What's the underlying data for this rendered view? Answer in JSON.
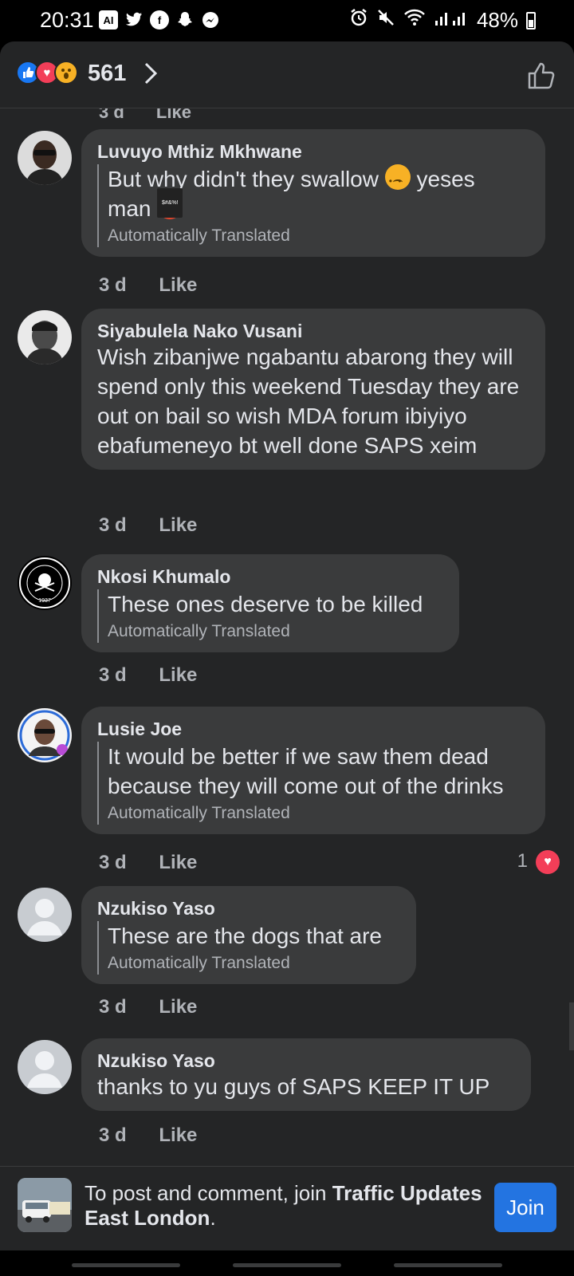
{
  "status_bar": {
    "time": "20:31",
    "left_icons": [
      "ai-icon",
      "twitter-icon",
      "facebook-icon",
      "snapchat-icon",
      "messenger-icon"
    ],
    "ai_label": "AI",
    "battery": "48%"
  },
  "reactions": {
    "icons": [
      "like",
      "love",
      "wow"
    ],
    "count": "561"
  },
  "ghost_meta": {
    "time": "3 d",
    "like": "Like"
  },
  "comments": [
    {
      "author": "Luvuyo Mthiz Mkhwane",
      "text_a": "But why didn't they swallow",
      "text_b": "yeses",
      "text_c": "man",
      "auto_translated": "Automatically Translated",
      "time": "3 d",
      "like": "Like"
    },
    {
      "author": "Siyabulela Nako Vusani",
      "text": "Wish zibanjwe ngabantu abarong they will spend only this weekend Tuesday they are out on bail so wish MDA forum ibiyiyo ebafumeneyo bt well done SAPS xeim",
      "time": "3 d",
      "like": "Like"
    },
    {
      "author": "Nkosi Khumalo",
      "text": "These ones deserve to be killed",
      "auto_translated": "Automatically Translated",
      "time": "3 d",
      "like": "Like",
      "avatar_text": "1937"
    },
    {
      "author": "Lusie Joe",
      "text": "It would be better if we saw them dead because they will come out of the drinks",
      "auto_translated": "Automatically Translated",
      "time": "3 d",
      "like": "Like",
      "reaction_count": "1"
    },
    {
      "author": "Nzukiso Yaso",
      "text": "These are the dogs that are",
      "auto_translated": "Automatically Translated",
      "time": "3 d",
      "like": "Like"
    },
    {
      "author": "Nzukiso Yaso",
      "text": "thanks to yu guys of SAPS KEEP IT UP",
      "time": "3 d",
      "like": "Like"
    }
  ],
  "join_bar": {
    "prefix": "To post and comment, join ",
    "group_name": "Traffic Updates East London",
    "suffix": ".",
    "button": "Join"
  },
  "colors": {
    "background": "#242526",
    "bubble": "#3a3b3c",
    "accent": "#2374e1",
    "love": "#f33e58"
  }
}
